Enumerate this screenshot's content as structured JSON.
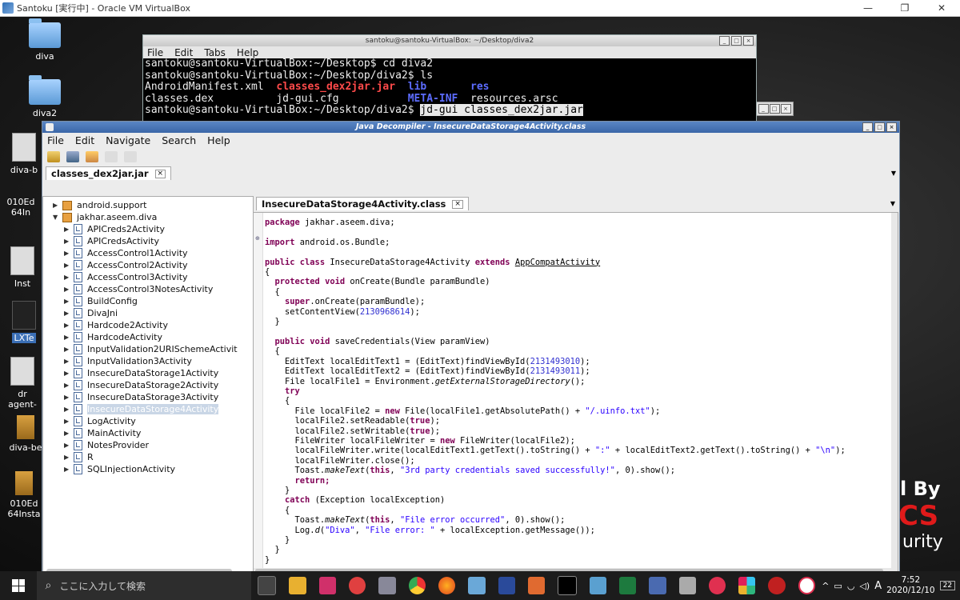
{
  "host_window": {
    "title": "Santoku [実行中] - Oracle VM VirtualBox",
    "controls": [
      "—",
      "❐",
      "✕"
    ]
  },
  "desktop_icons": [
    {
      "label": "diva"
    },
    {
      "label": "diva2"
    },
    {
      "label": "diva-b"
    },
    {
      "label": "010Ed"
    },
    {
      "label": "64In"
    },
    {
      "label": "Inst"
    },
    {
      "label": "LXTe"
    },
    {
      "label": "dr"
    },
    {
      "label": "agent-"
    },
    {
      "label": "diva-be"
    },
    {
      "label": "010Ed"
    },
    {
      "label": "64Insta"
    }
  ],
  "wallpaper_text": {
    "line1": "l By",
    "line2": "CS",
    "line3": "urity"
  },
  "terminal": {
    "title": "santoku@santoku-VirtualBox: ~/Desktop/diva2",
    "menu": [
      "File",
      "Edit",
      "Tabs",
      "Help"
    ],
    "lines": {
      "l1": "santoku@santoku-VirtualBox:~/Desktop$ cd diva2",
      "l2": "santoku@santoku-VirtualBox:~/Desktop/diva2$ ls",
      "l3_a": "AndroidManifest.xml  ",
      "l3_b": "classes_dex2jar.jar",
      "l3_c": "lib",
      "l3_d": "res",
      "l4_a": "classes.dex          jd-gui.cfg           ",
      "l4_b": "META-INF",
      "l4_c": "  resources.arsc",
      "l5_a": "santoku@santoku-VirtualBox:~/Desktop/diva2$ ",
      "l5_b": "jd-gui classes_dex2jar.jar"
    }
  },
  "jdgui": {
    "title": "Java Decompiler - InsecureDataStorage4Activity.class",
    "menu": [
      "File",
      "Edit",
      "Navigate",
      "Search",
      "Help"
    ],
    "file_tab": "classes_dex2jar.jar",
    "editor_tab": "InsecureDataStorage4Activity.class",
    "tree": {
      "pkg1": "android.support",
      "pkg2": "jakhar.aseem.diva",
      "classes": [
        "APICreds2Activity",
        "APICredsActivity",
        "AccessControl1Activity",
        "AccessControl2Activity",
        "AccessControl3Activity",
        "AccessControl3NotesActivity",
        "BuildConfig",
        "DivaJni",
        "Hardcode2Activity",
        "HardcodeActivity",
        "InputValidation2URISchemeActivit",
        "InputValidation3Activity",
        "InsecureDataStorage1Activity",
        "InsecureDataStorage2Activity",
        "InsecureDataStorage3Activity",
        "InsecureDataStorage4Activity",
        "LogActivity",
        "MainActivity",
        "NotesProvider",
        "R",
        "SQLInjectionActivity"
      ],
      "selected_index": 15
    },
    "code": {
      "c1a": "package",
      "c1b": " jakhar.aseem.diva;",
      "c2a": "import",
      "c2b": " android.os.Bundle;",
      "c3a": "public class",
      "c3b": " InsecureDataStorage4Activity ",
      "c3c": "extends",
      "c3d": "AppCompatActivity",
      "c4": "{",
      "c5a": "  protected void",
      "c5b": " onCreate(Bundle paramBundle)",
      "c6": "  {",
      "c7a": "    super",
      "c7b": ".onCreate(paramBundle);",
      "c8a": "    setContentView(",
      "c8b": "2130968614",
      "c8c": ");",
      "c9": "  }",
      "c10a": "  public void",
      "c10b": " saveCredentials(View paramView)",
      "c11": "  {",
      "c12a": "    EditText localEditText1 = (EditText)findViewById(",
      "c12b": "2131493010",
      "c12c": ");",
      "c13a": "    EditText localEditText2 = (EditText)findViewById(",
      "c13b": "2131493011",
      "c13c": ");",
      "c14a": "    File localFile1 = Environment.",
      "c14b": "getExternalStorageDirectory",
      "c14c": "();",
      "c15": "    try",
      "c16": "    {",
      "c17a": "      File localFile2 = ",
      "c17b": "new",
      "c17c": " File(localFile1.getAbsolutePath() + ",
      "c17d": "\"/.uinfo.txt\"",
      "c17e": ");",
      "c18a": "      localFile2.setReadable(",
      "c18b": "true",
      "c18c": ");",
      "c19a": "      localFile2.setWritable(",
      "c19b": "true",
      "c19c": ");",
      "c20a": "      FileWriter localFileWriter = ",
      "c20b": "new",
      "c20c": " FileWriter(localFile2);",
      "c21a": "      localFileWriter.write(localEditText1.getText().toString() + ",
      "c21b": "\":\"",
      "c21c": " + localEditText2.getText().toString() + ",
      "c21d": "\"\\n\"",
      "c21e": ");",
      "c22": "      localFileWriter.close();",
      "c23a": "      Toast.",
      "c23b": "makeText",
      "c23c": "(",
      "c23d": "this",
      "c23e": ", ",
      "c23f": "\"3rd party credentials saved successfully!\"",
      "c23g": ", 0).show();",
      "c24": "      return;",
      "c25": "    }",
      "c26a": "    catch",
      "c26b": " (Exception localException)",
      "c27": "    {",
      "c28a": "      Toast.",
      "c28b": "makeText",
      "c28c": "(",
      "c28d": "this",
      "c28e": ", ",
      "c28f": "\"File error occurred\"",
      "c28g": ", 0).show();",
      "c29a": "      Log.",
      "c29b": "d",
      "c29c": "(",
      "c29d": "\"Diva\"",
      "c29e": ", ",
      "c29f": "\"File error: \"",
      "c29g": " + localException.getMessage());",
      "c30": "    }",
      "c31": "  }",
      "c32": "}"
    }
  },
  "taskbar": {
    "search_placeholder": "ここに入力して検索",
    "ime": "A",
    "time": "7:52",
    "date": "2020/12/10",
    "notifications": "22"
  }
}
